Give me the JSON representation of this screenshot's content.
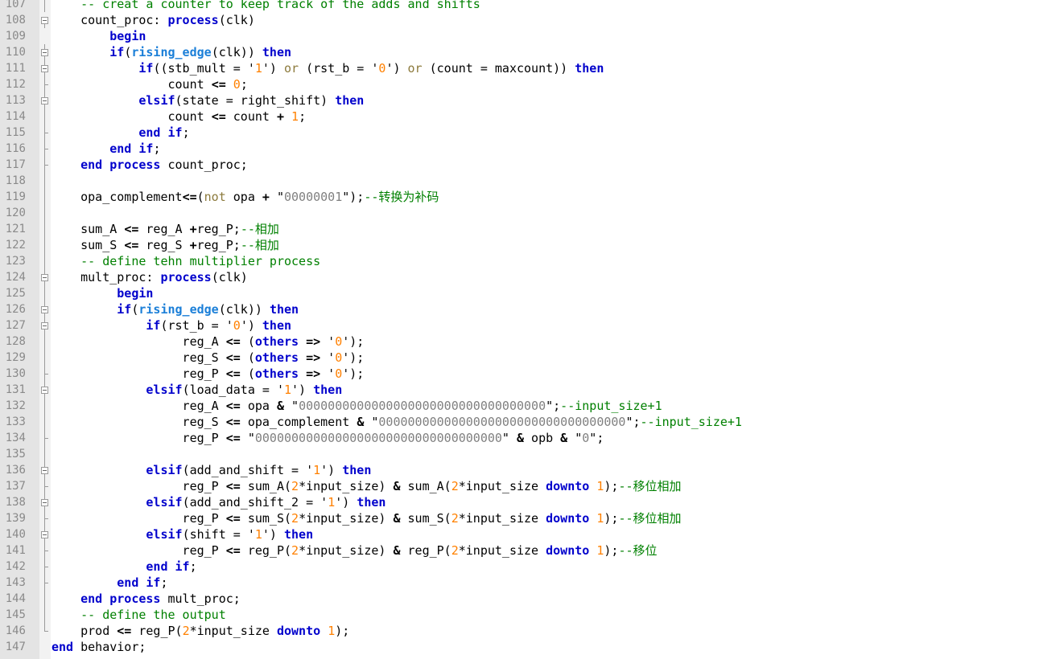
{
  "editor": {
    "first_line_number": 107,
    "fold_markers": {
      "108": "box",
      "110": "box",
      "111": "box",
      "112": "end",
      "113": "box",
      "114": "line",
      "115": "end",
      "116": "end",
      "117": "end",
      "118": "line",
      "119": "line",
      "120": "line",
      "121": "line",
      "122": "line",
      "123": "line",
      "124": "box",
      "125": "line",
      "126": "box",
      "127": "box",
      "128": "line",
      "129": "line",
      "130": "end",
      "131": "box",
      "132": "line",
      "133": "line",
      "134": "end",
      "135": "line",
      "136": "box",
      "137": "end",
      "138": "box",
      "139": "end",
      "140": "box",
      "141": "end",
      "142": "end",
      "143": "end",
      "144": "line",
      "145": "line",
      "146": "end",
      "107": "line"
    },
    "lines": [
      [
        [
          "    ",
          ""
        ],
        [
          "-- creat a counter to keep track of the adds and shifts",
          "cm"
        ]
      ],
      [
        [
          "    count_proc: ",
          ""
        ],
        [
          "process",
          "kw"
        ],
        [
          "(clk)",
          ""
        ]
      ],
      [
        [
          "        ",
          ""
        ],
        [
          "begin",
          "kw"
        ]
      ],
      [
        [
          "        ",
          ""
        ],
        [
          "if",
          "kw"
        ],
        [
          "(",
          ""
        ],
        [
          "rising_edge",
          "fn"
        ],
        [
          "(clk)) ",
          ""
        ],
        [
          "then",
          "kw"
        ]
      ],
      [
        [
          "            ",
          ""
        ],
        [
          "if",
          "kw"
        ],
        [
          "((stb_mult = '",
          ""
        ],
        [
          "1",
          "num"
        ],
        [
          "') ",
          ""
        ],
        [
          "or",
          "lo"
        ],
        [
          " (rst_b = '",
          ""
        ],
        [
          "0",
          "num"
        ],
        [
          "') ",
          ""
        ],
        [
          "or",
          "lo"
        ],
        [
          " (count = maxcount)) ",
          ""
        ],
        [
          "then",
          "kw"
        ]
      ],
      [
        [
          "                count ",
          ""
        ],
        [
          "<=",
          "op"
        ],
        [
          " ",
          ""
        ],
        [
          "0",
          "num"
        ],
        [
          ";",
          ""
        ]
      ],
      [
        [
          "            ",
          ""
        ],
        [
          "elsif",
          "kw"
        ],
        [
          "(state = right_shift) ",
          ""
        ],
        [
          "then",
          "kw"
        ]
      ],
      [
        [
          "                count ",
          ""
        ],
        [
          "<=",
          "op"
        ],
        [
          " count ",
          ""
        ],
        [
          "+",
          "op"
        ],
        [
          " ",
          ""
        ],
        [
          "1",
          "num"
        ],
        [
          ";",
          ""
        ]
      ],
      [
        [
          "            ",
          ""
        ],
        [
          "end if",
          "kw"
        ],
        [
          ";",
          ""
        ]
      ],
      [
        [
          "        ",
          ""
        ],
        [
          "end if",
          "kw"
        ],
        [
          ";",
          ""
        ]
      ],
      [
        [
          "    ",
          ""
        ],
        [
          "end process",
          "kw"
        ],
        [
          " count_proc;",
          ""
        ]
      ],
      [
        [
          "",
          ""
        ]
      ],
      [
        [
          "    opa_complement",
          ""
        ],
        [
          "<=",
          "op"
        ],
        [
          "(",
          ""
        ],
        [
          "not",
          "lo"
        ],
        [
          " opa ",
          ""
        ],
        [
          "+",
          "op"
        ],
        [
          " \"",
          ""
        ],
        [
          "00000001",
          "str"
        ],
        [
          "\");",
          ""
        ],
        [
          "--转换为补码",
          "cm"
        ]
      ],
      [
        [
          "",
          ""
        ]
      ],
      [
        [
          "    sum_A ",
          ""
        ],
        [
          "<=",
          "op"
        ],
        [
          " reg_A ",
          ""
        ],
        [
          "+",
          "op"
        ],
        [
          "reg_P;",
          ""
        ],
        [
          "--相加",
          "cm"
        ]
      ],
      [
        [
          "    sum_S ",
          ""
        ],
        [
          "<=",
          "op"
        ],
        [
          " reg_S ",
          ""
        ],
        [
          "+",
          "op"
        ],
        [
          "reg_P;",
          ""
        ],
        [
          "--相加",
          "cm"
        ]
      ],
      [
        [
          "    ",
          ""
        ],
        [
          "-- define tehn multiplier process",
          "cm"
        ]
      ],
      [
        [
          "    mult_proc: ",
          ""
        ],
        [
          "process",
          "kw"
        ],
        [
          "(clk)",
          ""
        ]
      ],
      [
        [
          "         ",
          ""
        ],
        [
          "begin",
          "kw"
        ]
      ],
      [
        [
          "         ",
          ""
        ],
        [
          "if",
          "kw"
        ],
        [
          "(",
          ""
        ],
        [
          "rising_edge",
          "fn"
        ],
        [
          "(clk)) ",
          ""
        ],
        [
          "then",
          "kw"
        ]
      ],
      [
        [
          "             ",
          ""
        ],
        [
          "if",
          "kw"
        ],
        [
          "(rst_b = '",
          ""
        ],
        [
          "0",
          "num"
        ],
        [
          "') ",
          ""
        ],
        [
          "then",
          "kw"
        ]
      ],
      [
        [
          "                  reg_A ",
          ""
        ],
        [
          "<=",
          "op"
        ],
        [
          " (",
          ""
        ],
        [
          "others",
          "kw"
        ],
        [
          " ",
          ""
        ],
        [
          "=>",
          "op"
        ],
        [
          " '",
          ""
        ],
        [
          "0",
          "num"
        ],
        [
          "');",
          ""
        ]
      ],
      [
        [
          "                  reg_S ",
          ""
        ],
        [
          "<=",
          "op"
        ],
        [
          " (",
          ""
        ],
        [
          "others",
          "kw"
        ],
        [
          " ",
          ""
        ],
        [
          "=>",
          "op"
        ],
        [
          " '",
          ""
        ],
        [
          "0",
          "num"
        ],
        [
          "');",
          ""
        ]
      ],
      [
        [
          "                  reg_P ",
          ""
        ],
        [
          "<=",
          "op"
        ],
        [
          " (",
          ""
        ],
        [
          "others",
          "kw"
        ],
        [
          " ",
          ""
        ],
        [
          "=>",
          "op"
        ],
        [
          " '",
          ""
        ],
        [
          "0",
          "num"
        ],
        [
          "');",
          ""
        ]
      ],
      [
        [
          "             ",
          ""
        ],
        [
          "elsif",
          "kw"
        ],
        [
          "(load_data = '",
          ""
        ],
        [
          "1",
          "num"
        ],
        [
          "') ",
          ""
        ],
        [
          "then",
          "kw"
        ]
      ],
      [
        [
          "                  reg_A ",
          ""
        ],
        [
          "<=",
          "op"
        ],
        [
          " opa ",
          ""
        ],
        [
          "&",
          "op"
        ],
        [
          " \"",
          ""
        ],
        [
          "0000000000000000000000000000000000",
          "str"
        ],
        [
          "\";",
          ""
        ],
        [
          "--input_size+1",
          "cm"
        ]
      ],
      [
        [
          "                  reg_S ",
          ""
        ],
        [
          "<=",
          "op"
        ],
        [
          " opa_complement ",
          ""
        ],
        [
          "&",
          "op"
        ],
        [
          " \"",
          ""
        ],
        [
          "0000000000000000000000000000000000",
          "str"
        ],
        [
          "\";",
          ""
        ],
        [
          "--input_size+1",
          "cm"
        ]
      ],
      [
        [
          "                  reg_P ",
          ""
        ],
        [
          "<=",
          "op"
        ],
        [
          " \"",
          ""
        ],
        [
          "0000000000000000000000000000000000",
          "str"
        ],
        [
          "\" ",
          ""
        ],
        [
          "&",
          "op"
        ],
        [
          " opb ",
          ""
        ],
        [
          "&",
          "op"
        ],
        [
          " \"",
          ""
        ],
        [
          "0",
          "str"
        ],
        [
          "\";",
          ""
        ]
      ],
      [
        [
          "",
          ""
        ]
      ],
      [
        [
          "             ",
          ""
        ],
        [
          "elsif",
          "kw"
        ],
        [
          "(add_and_shift = '",
          ""
        ],
        [
          "1",
          "num"
        ],
        [
          "') ",
          ""
        ],
        [
          "then",
          "kw"
        ]
      ],
      [
        [
          "                  reg_P ",
          ""
        ],
        [
          "<=",
          "op"
        ],
        [
          " sum_A(",
          ""
        ],
        [
          "2",
          "num"
        ],
        [
          "*input_size) ",
          ""
        ],
        [
          "&",
          "op"
        ],
        [
          " sum_A(",
          ""
        ],
        [
          "2",
          "num"
        ],
        [
          "*input_size ",
          ""
        ],
        [
          "downto",
          "kw"
        ],
        [
          " ",
          ""
        ],
        [
          "1",
          "num"
        ],
        [
          ");",
          ""
        ],
        [
          "--移位相加",
          "cm"
        ]
      ],
      [
        [
          "             ",
          ""
        ],
        [
          "elsif",
          "kw"
        ],
        [
          "(add_and_shift_2 = '",
          ""
        ],
        [
          "1",
          "num"
        ],
        [
          "') ",
          ""
        ],
        [
          "then",
          "kw"
        ]
      ],
      [
        [
          "                  reg_P ",
          ""
        ],
        [
          "<=",
          "op"
        ],
        [
          " sum_S(",
          ""
        ],
        [
          "2",
          "num"
        ],
        [
          "*input_size) ",
          ""
        ],
        [
          "&",
          "op"
        ],
        [
          " sum_S(",
          ""
        ],
        [
          "2",
          "num"
        ],
        [
          "*input_size ",
          ""
        ],
        [
          "downto",
          "kw"
        ],
        [
          " ",
          ""
        ],
        [
          "1",
          "num"
        ],
        [
          ");",
          ""
        ],
        [
          "--移位相加",
          "cm"
        ]
      ],
      [
        [
          "             ",
          ""
        ],
        [
          "elsif",
          "kw"
        ],
        [
          "(shift = '",
          ""
        ],
        [
          "1",
          "num"
        ],
        [
          "') ",
          ""
        ],
        [
          "then",
          "kw"
        ]
      ],
      [
        [
          "                  reg_P ",
          ""
        ],
        [
          "<=",
          "op"
        ],
        [
          " reg_P(",
          ""
        ],
        [
          "2",
          "num"
        ],
        [
          "*input_size) ",
          ""
        ],
        [
          "&",
          "op"
        ],
        [
          " reg_P(",
          ""
        ],
        [
          "2",
          "num"
        ],
        [
          "*input_size ",
          ""
        ],
        [
          "downto",
          "kw"
        ],
        [
          " ",
          ""
        ],
        [
          "1",
          "num"
        ],
        [
          ");",
          ""
        ],
        [
          "--移位",
          "cm"
        ]
      ],
      [
        [
          "             ",
          ""
        ],
        [
          "end if",
          "kw"
        ],
        [
          ";",
          ""
        ]
      ],
      [
        [
          "         ",
          ""
        ],
        [
          "end if",
          "kw"
        ],
        [
          ";",
          ""
        ]
      ],
      [
        [
          "    ",
          ""
        ],
        [
          "end process",
          "kw"
        ],
        [
          " mult_proc;",
          ""
        ]
      ],
      [
        [
          "    ",
          ""
        ],
        [
          "-- define the output",
          "cm"
        ]
      ],
      [
        [
          "    prod ",
          ""
        ],
        [
          "<=",
          "op"
        ],
        [
          " reg_P(",
          ""
        ],
        [
          "2",
          "num"
        ],
        [
          "*input_size ",
          ""
        ],
        [
          "downto",
          "kw"
        ],
        [
          " ",
          ""
        ],
        [
          "1",
          "num"
        ],
        [
          ");",
          ""
        ]
      ],
      [
        [
          "",
          ""
        ],
        [
          "end",
          "kw"
        ],
        [
          " behavior;",
          ""
        ]
      ]
    ]
  }
}
